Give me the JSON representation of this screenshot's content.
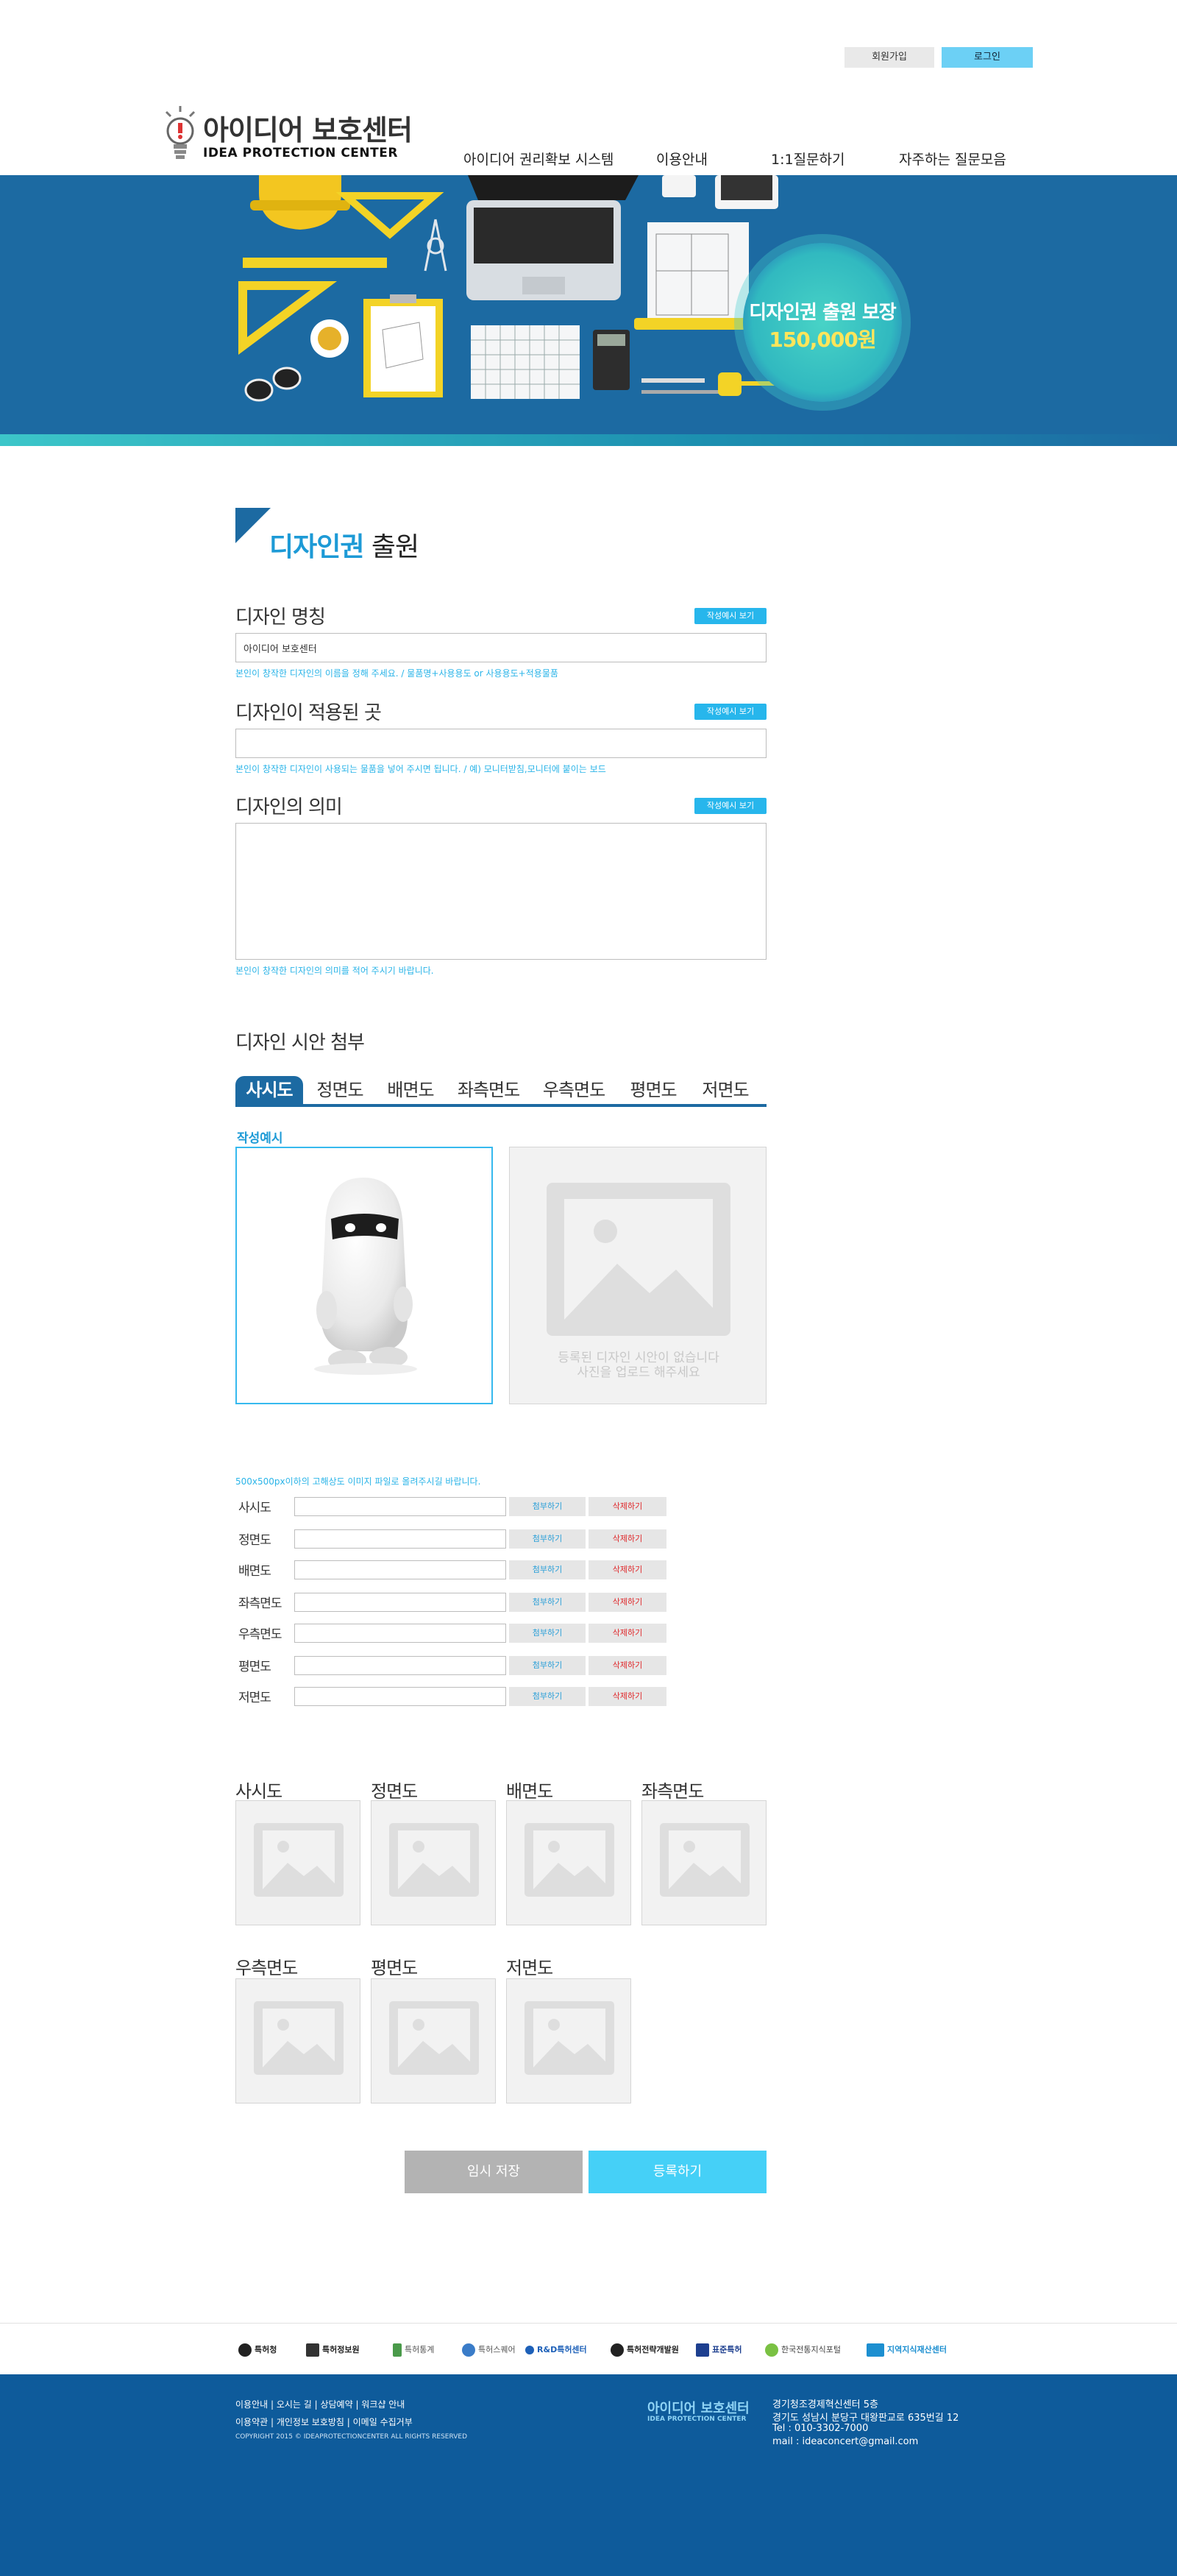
{
  "header": {
    "join_label": "회원가입",
    "login_label": "로그인",
    "logo_ko": "아이디어 보호센터",
    "logo_en": "IDEA PROTECTION CENTER",
    "nav": [
      "아이디어 권리확보 시스템",
      "이용안내",
      "1:1질문하기",
      "자주하는 질문모음"
    ]
  },
  "banner": {
    "badge_line1": "디자인권 출원 보장",
    "badge_line2": "150,000원"
  },
  "page": {
    "title_accent": "디자인권",
    "title_rest": " 출원"
  },
  "form": {
    "example_button": "작성예시 보기",
    "name_label": "디자인 명칭",
    "name_value": "아이디어 보호센터",
    "name_hint": "본인이 창작한 디자인의 이름을 정해 주세요. / 물품명+사용용도 or 사용용도+적용물품",
    "applied_label": "디자인이 적용된 곳",
    "applied_value": "",
    "applied_hint": "본인이 창작한 디자인이 사용되는 물품을 넣어 주시면 됩니다. / 예) 모니터받침,모니터에 붙이는 보드",
    "meaning_label": "디자인의 의미",
    "meaning_hint": "본인이 창작한 디자인의 의미를 적어 주시기 바랍니다."
  },
  "attach": {
    "section_title": "디자인 시안 첨부",
    "tabs": [
      "사시도",
      "정면도",
      "배면도",
      "좌측면도",
      "우측면도",
      "평면도",
      "저면도"
    ],
    "example_label": "작성예시",
    "upload_message_line1": "등록된 디자인 시안이 없습니다",
    "upload_message_line2": "사진을 업로드 해주세요",
    "upload_hint": "500x500px이하의 고해상도 이미지 파일로 올려주시길 바랍니다.",
    "rows": [
      "사시도",
      "정면도",
      "배면도",
      "좌측면도",
      "우측면도",
      "평면도",
      "저면도"
    ],
    "attach_label": "첨부하기",
    "delete_label": "삭제하기"
  },
  "thumbs": [
    "사시도",
    "정면도",
    "배면도",
    "좌측면도",
    "우측면도",
    "평면도",
    "저면도"
  ],
  "actions": {
    "temp_save": "임시 저장",
    "submit": "등록하기"
  },
  "partners": [
    "특허청",
    "특허정보원",
    "특허통계",
    "특허스퀘어",
    "R&D특허센터",
    "특허전략개발원",
    "표준특허",
    "한국전통지식포털",
    "지역지식재산센터"
  ],
  "footer": {
    "links_line1": "이용안내   |   오시는 길   |   상담예약   |   워크샵 안내",
    "links_line2": "이용약관   |   개인정보 보호방침   |   이메일 수집거부",
    "copyright": "COPYRIGHT 2015 © IDEAPROTECTIONCENTER ALL RIGHTS RESERVED",
    "logo_ko": "아이디어 보호센터",
    "logo_en": "IDEA PROTECTION CENTER",
    "address_line1": "경기청조경제혁신센터 5층",
    "address_line2": "경기도 성남시 분당구 대왕판교로 635번길 12",
    "tel": "Tel : 010-3302-7000",
    "mail": "mail : ideaconcert@gmail.com"
  },
  "colors": {
    "brand_blue": "#1c6aa2",
    "accent_cyan": "#27b6ec",
    "submit_cyan": "#45d0f7",
    "delete_red": "#e0282b",
    "footer_blue": "#0e5b9b"
  }
}
